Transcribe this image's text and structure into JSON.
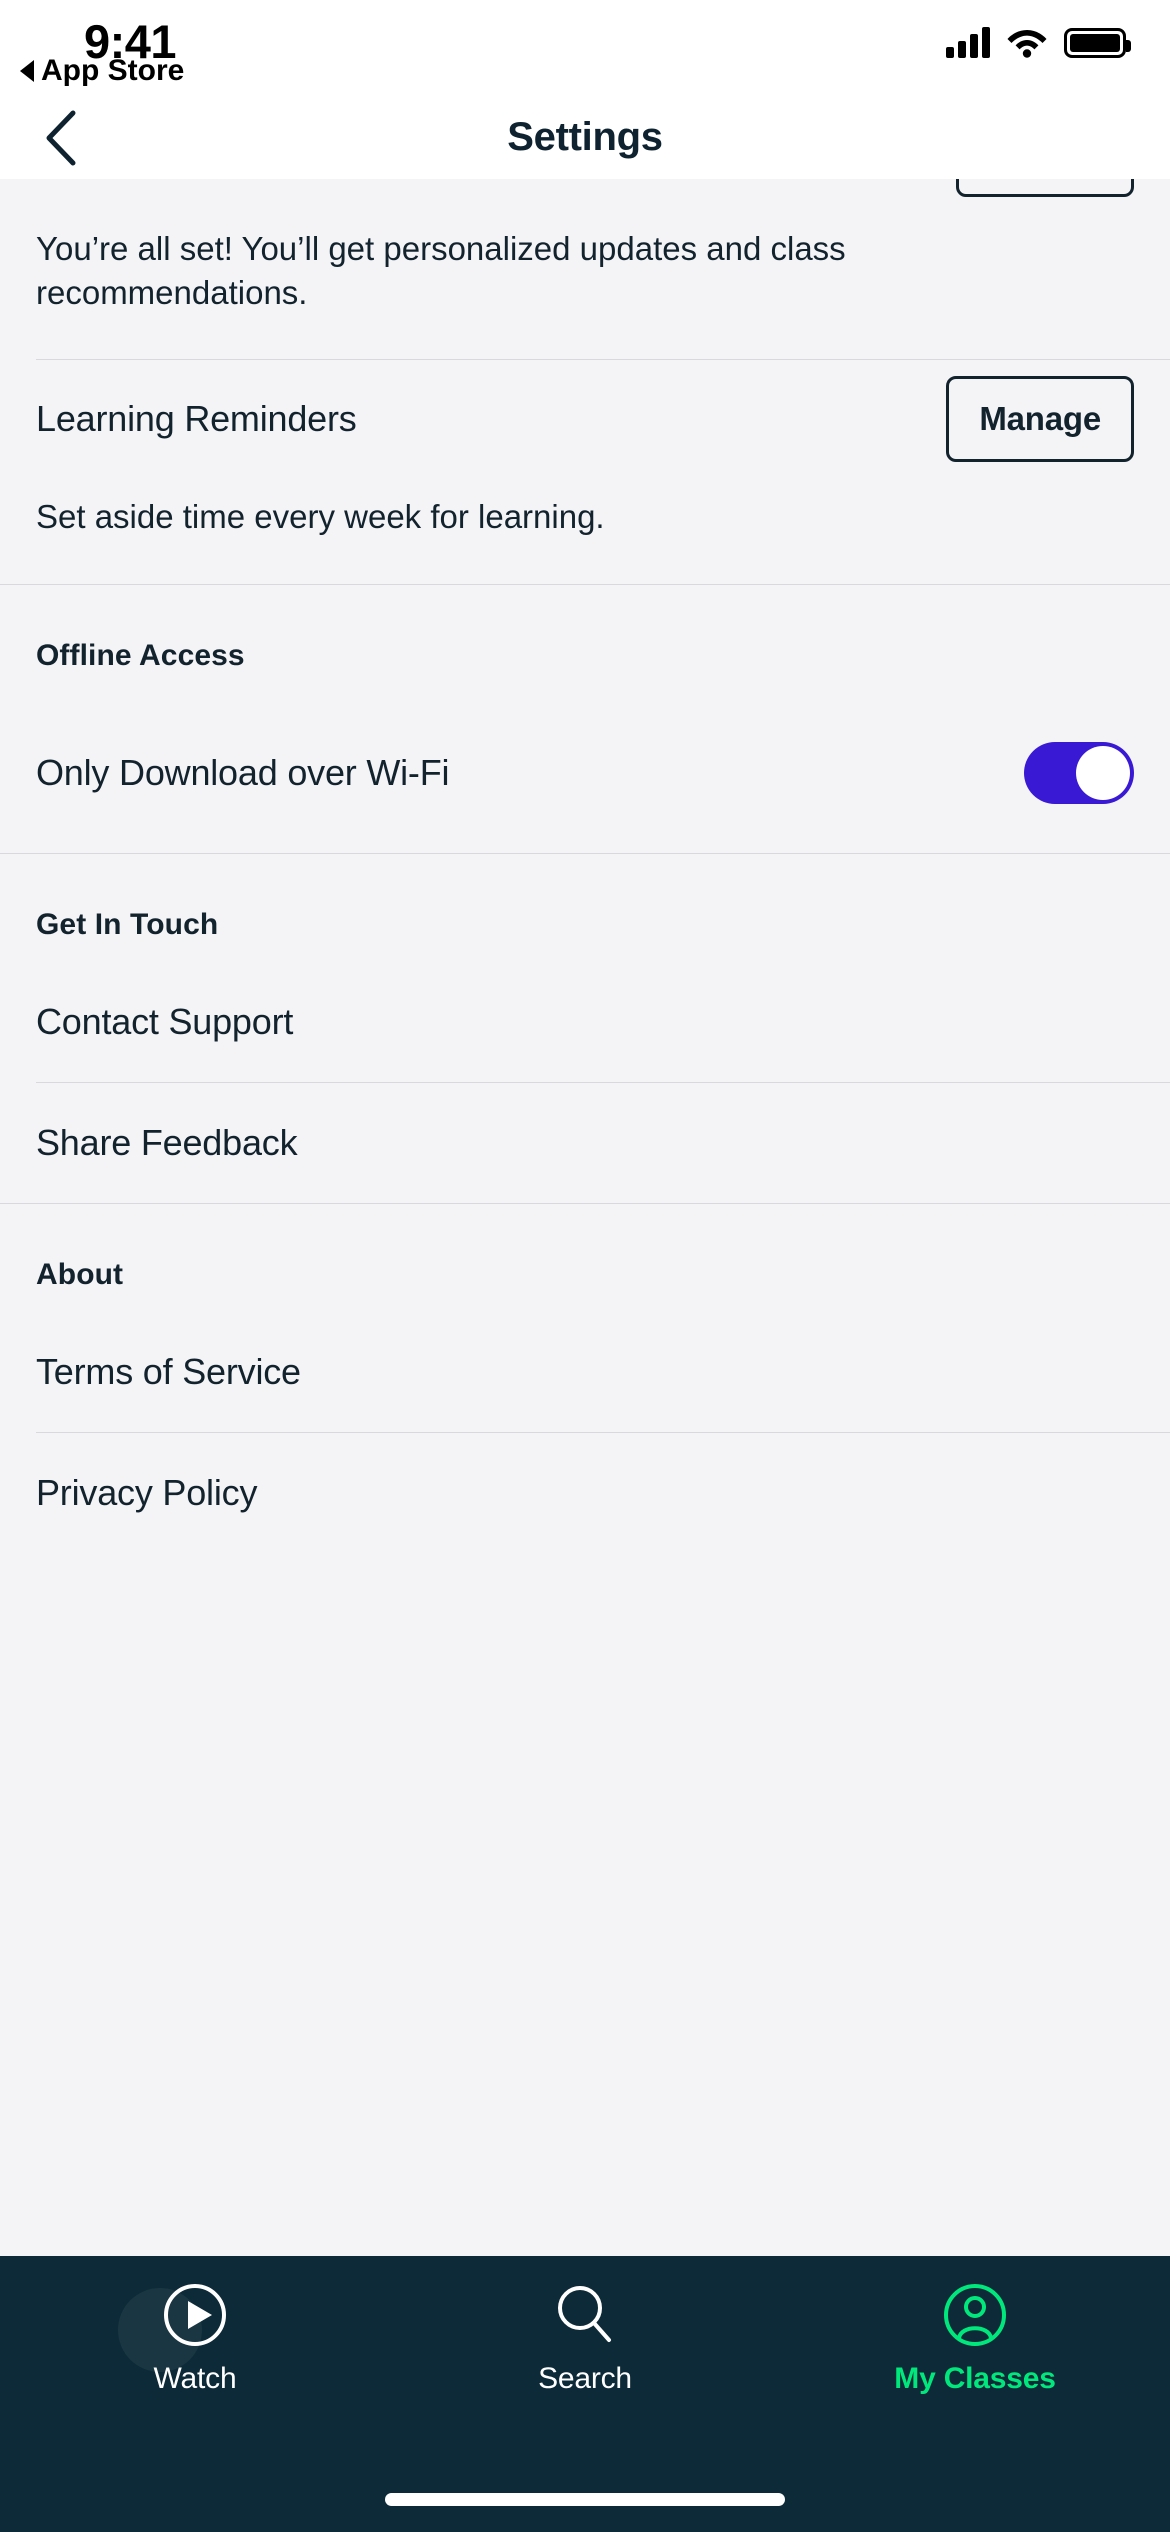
{
  "status_bar": {
    "time": "9:41",
    "return_app": "App Store",
    "icons": [
      "cellular-signal-icon",
      "wifi-icon",
      "battery-icon"
    ]
  },
  "nav": {
    "back_icon": "chevron-left-icon",
    "title": "Settings"
  },
  "sections": [
    {
      "id": "notifications",
      "clipped_button": true,
      "paragraph": "You’re all set! You’ll get personalized updates and class recommendations."
    },
    {
      "id": "learning-reminders",
      "row_label": "Learning Reminders",
      "action_label": "Manage",
      "subtext": "Set aside time every week for learning."
    },
    {
      "id": "offline-access",
      "heading": "Offline Access",
      "row_label": "Only Download over Wi-Fi",
      "toggle_on": true
    },
    {
      "id": "get-in-touch",
      "heading": "Get In Touch",
      "links": [
        "Contact Support",
        "Share Feedback"
      ]
    },
    {
      "id": "about",
      "heading": "About",
      "links": [
        "Terms of Service",
        "Privacy Policy"
      ]
    }
  ],
  "labels": {
    "notifications_paragraph": "You’re all set! You’ll get personalized updates and class recommendations.",
    "learning_reminders": "Learning Reminders",
    "manage": "Manage",
    "reminders_subtext": "Set aside time every week for learning.",
    "offline_access_heading": "Offline Access",
    "only_download_wifi": "Only Download over Wi-Fi",
    "get_in_touch_heading": "Get In Touch",
    "contact_support": "Contact Support",
    "share_feedback": "Share Feedback",
    "about_heading": "About",
    "terms_of_service": "Terms of Service",
    "privacy_policy": "Privacy Policy"
  },
  "tabbar": {
    "items": [
      {
        "label": "Watch",
        "icon": "play-circle-icon",
        "active": false
      },
      {
        "label": "Search",
        "icon": "search-icon",
        "active": false
      },
      {
        "label": "My Classes",
        "icon": "account-circle-icon",
        "active": true
      }
    ]
  },
  "colors": {
    "background": "#F4F3F6",
    "text": "#12232E",
    "toggle_on": "#3A19D4",
    "tabbar_background": "#0C2A38",
    "tab_active": "#00E87B",
    "divider": "#D9D8DD"
  }
}
